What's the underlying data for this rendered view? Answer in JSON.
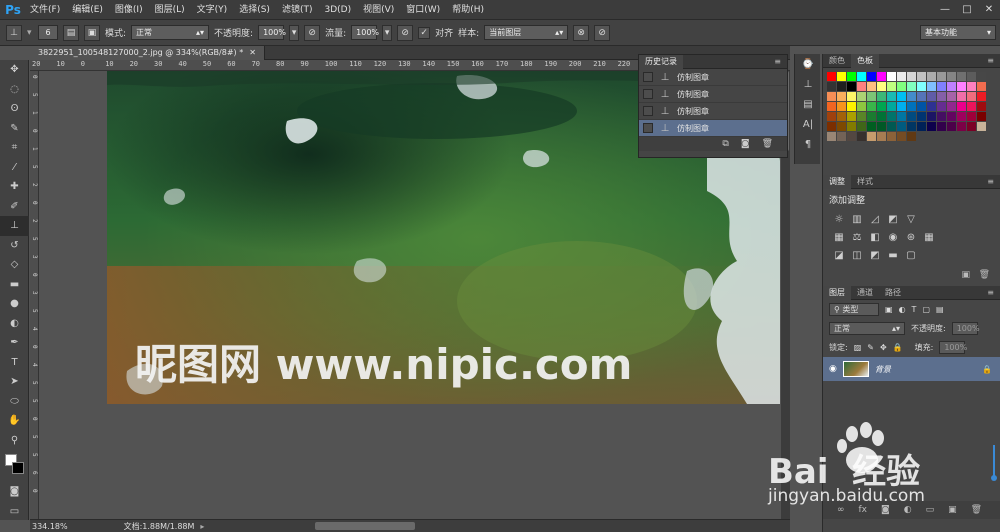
{
  "app": {
    "logo": "Ps"
  },
  "menu": [
    "文件(F)",
    "编辑(E)",
    "图像(I)",
    "图层(L)",
    "文字(Y)",
    "选择(S)",
    "滤镜(T)",
    "3D(D)",
    "视图(V)",
    "窗口(W)",
    "帮助(H)"
  ],
  "window_controls": [
    "—",
    "□",
    "✕"
  ],
  "options": {
    "brush_size": "6",
    "mode_label": "模式:",
    "mode_value": "正常",
    "opacity_label": "不透明度:",
    "opacity_value": "100%",
    "flow_label": "流量:",
    "flow_value": "100%",
    "align_label": "对齐",
    "sample_label": "样本:",
    "sample_value": "当前图层",
    "workspace": "基本功能"
  },
  "document": {
    "tab_title": "3822951_100548127000_2.jpg @ 334%(RGB/8#) *",
    "zoom": "334.18%",
    "doc_size": "文档:1.88M/1.88M"
  },
  "ruler_top": [
    "20",
    "10",
    "0",
    "10",
    "20",
    "30",
    "40",
    "50",
    "60",
    "70",
    "80",
    "90",
    "100",
    "110",
    "120",
    "130",
    "140",
    "150",
    "160",
    "170",
    "180",
    "190",
    "200",
    "210",
    "220",
    "230",
    "240",
    "250",
    "260",
    "270",
    "280"
  ],
  "ruler_left": [
    "0",
    "5",
    "1",
    "0",
    "1",
    "5",
    "2",
    "0",
    "2",
    "5",
    "3",
    "0",
    "3",
    "5",
    "4",
    "0",
    "4",
    "5",
    "5",
    "0",
    "5",
    "5",
    "6",
    "0"
  ],
  "canvas": {
    "watermark": "昵图网 www.nipic.com"
  },
  "history": {
    "tabs": [
      "历史记录"
    ],
    "items": [
      {
        "label": "仿制图章",
        "selected": false
      },
      {
        "label": "仿制图章",
        "selected": false
      },
      {
        "label": "仿制图章",
        "selected": false
      },
      {
        "label": "仿制图章",
        "selected": true
      }
    ]
  },
  "color_panel": {
    "tabs": [
      "颜色",
      "色板"
    ]
  },
  "adjust_panel": {
    "tabs": [
      "调整",
      "样式"
    ],
    "title": "添加调整"
  },
  "layers_panel": {
    "tabs": [
      "图层",
      "通道",
      "路径"
    ],
    "filter_label": "类型",
    "blend_mode": "正常",
    "opacity_label": "不透明度:",
    "opacity_value": "100%",
    "lock_label": "锁定:",
    "fill_label": "填充:",
    "fill_value": "100%",
    "layer_name": "背景"
  },
  "baidu_watermark": {
    "text": "Bai  经验",
    "url": "jingyan.baidu.com"
  },
  "colors": {
    "accent": "#5c6f8e",
    "ps_blue": "#2fa3f5"
  }
}
